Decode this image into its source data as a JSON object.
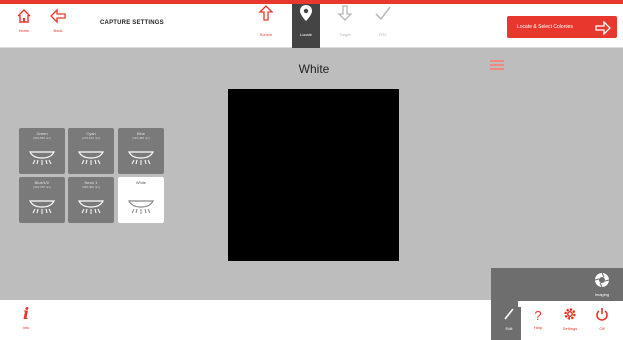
{
  "header": {
    "home_label": "Home",
    "back_label": "Back",
    "title": "CAPTURE SETTINGS",
    "home_icon": "home-icon",
    "back_icon": "arrow-left-icon",
    "steps": [
      {
        "label": "Source",
        "icon": "arrow-up-icon",
        "state": "current"
      },
      {
        "label": "Locate",
        "icon": "pin-icon",
        "state": "active"
      },
      {
        "label": "Target",
        "icon": "arrow-down-icon",
        "state": "dim"
      },
      {
        "label": "FRC",
        "icon": "check-icon",
        "state": "dim"
      }
    ],
    "action_label": "Locate & Select Colonies"
  },
  "main": {
    "title": "White",
    "tiles": [
      {
        "label": "Green",
        "sub": "(520-560 nm)"
      },
      {
        "label": "Cyan",
        "sub": "(470-510 nm)"
      },
      {
        "label": "Blue",
        "sub": "(445-485 nm)"
      },
      {
        "label": "Blue/UV",
        "sub": "(410-470 nm)"
      },
      {
        "label": "Neon 1",
        "sub": "(380-400 nm)"
      },
      {
        "label": "White",
        "sub": ""
      }
    ]
  },
  "footer": {
    "info_label": "Info"
  },
  "dock": {
    "imaging_label": "Imaging",
    "edit_label": "Edit",
    "help_label": "Help",
    "settings_label": "Settings",
    "off_label": "Off"
  },
  "colors": {
    "accent": "#e8372c",
    "background": "#bdbdbd",
    "tile": "#7a7a7a",
    "dock": "#6e6e6e"
  }
}
